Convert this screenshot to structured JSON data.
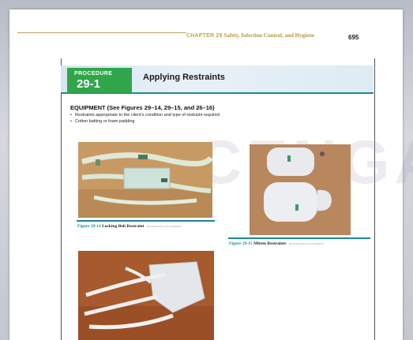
{
  "running_head": {
    "chapter": "CHAPTER 29",
    "title": "Safety, Infection Control, and Hygiene",
    "page_number": "695"
  },
  "procedure": {
    "label": "PROCEDURE",
    "number": "29-1",
    "title": "Applying Restraints"
  },
  "equipment": {
    "heading": "EQUIPMENT (See Figures 29–14, 29–15, and 26–16)",
    "items": [
      "Restraints appropriate to the client’s condition and type of restraint required",
      "Cotton batting or foam padding"
    ]
  },
  "figures": [
    {
      "number": "Figure 29-14",
      "name": "Locking Belt Restraint",
      "credit": "DELMAR/CENGAGE LEARNING"
    },
    {
      "number": "Figure 29-15",
      "name": "Mitten Restraints",
      "credit": "DELMAR/CENGAGE LEARNING"
    }
  ],
  "watermark": "CENGAGE",
  "colors": {
    "procedure_green": "#2fa64a",
    "teal_rule": "#1b8a94",
    "running_head_gold": "#c6a640"
  }
}
